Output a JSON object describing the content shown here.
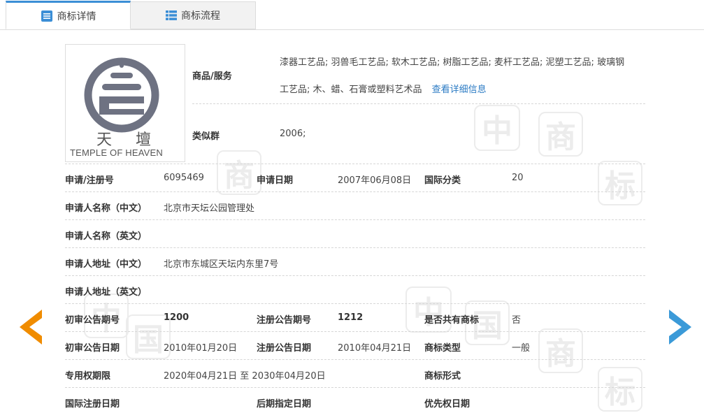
{
  "tabs": [
    {
      "label": "商标详情",
      "active": true,
      "icon": "list-icon"
    },
    {
      "label": "商标流程",
      "active": false,
      "icon": "grid-list-icon"
    }
  ],
  "logo": {
    "char1": "天",
    "char2": "壇",
    "text": "TEMPLE OF HEAVEN"
  },
  "goods": {
    "label": "商品/服务",
    "line1": "漆器工艺品; 羽兽毛工艺品; 软木工艺品; 树脂工艺品; 麦杆工艺品; 泥塑工艺品; 玻璃钢",
    "line2": "工艺品; 木、蜡、石膏或塑料艺术品",
    "detail_link": "查看详细信息"
  },
  "similar_group": {
    "label": "类似群",
    "value": "2006;"
  },
  "fields": {
    "reg_no_label": "申请/注册号",
    "reg_no": "6095469",
    "apply_date_label": "申请日期",
    "apply_date": "2007年06月08日",
    "intl_class_label": "国际分类",
    "intl_class": "20",
    "applicant_cn_label": "申请人名称（中文）",
    "applicant_cn": "北京市天坛公园管理处",
    "applicant_en_label": "申请人名称（英文）",
    "applicant_en": "",
    "address_cn_label": "申请人地址（中文）",
    "address_cn": "北京市东城区天坛内东里7号",
    "address_en_label": "申请人地址（英文）",
    "address_en": "",
    "prelim_issue_label": "初审公告期号",
    "prelim_issue": "1200",
    "reg_issue_label": "注册公告期号",
    "reg_issue": "1212",
    "shared_label": "是否共有商标",
    "shared": "否",
    "prelim_date_label": "初审公告日期",
    "prelim_date": "2010年01月20日",
    "reg_date_label": "注册公告日期",
    "reg_date": "2010年04月21日",
    "mark_type_label": "商标类型",
    "mark_type": "一般",
    "validity_label": "专用权期限",
    "validity": "2020年04月21日 至 2030年04月20日",
    "mark_form_label": "商标形式",
    "mark_form": "",
    "intl_reg_date_label": "国际注册日期",
    "intl_reg_date": "",
    "later_designation_label": "后期指定日期",
    "later_designation": "",
    "priority_date_label": "优先权日期",
    "priority_date": ""
  },
  "watermark_chars": [
    "中",
    "国",
    "商",
    "标"
  ],
  "colors": {
    "accent": "#3b8ed6",
    "link": "#2b7bc4",
    "prev_arrow": "#f08c00",
    "next_arrow": "#3b9ad8"
  }
}
